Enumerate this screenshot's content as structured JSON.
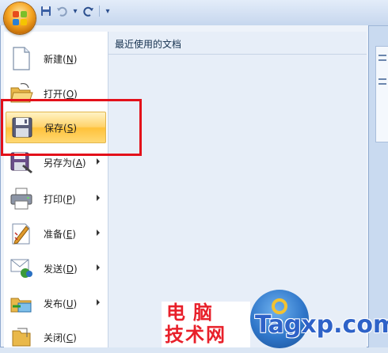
{
  "quick_access": {
    "icons": [
      "save-icon",
      "undo-icon",
      "undo-dropdown-icon",
      "redo-icon",
      "customize-icon"
    ],
    "customize_glyph": "▾"
  },
  "office_menu": {
    "items": [
      {
        "label": "新建",
        "key": "N",
        "icon": "new-document-icon",
        "submenu": false,
        "selected": false
      },
      {
        "label": "打开",
        "key": "O",
        "icon": "open-folder-icon",
        "submenu": false,
        "selected": false
      },
      {
        "label": "保存",
        "key": "S",
        "icon": "save-disk-icon",
        "submenu": false,
        "selected": true
      },
      {
        "label": "另存为",
        "key": "A",
        "icon": "save-as-icon",
        "submenu": true,
        "selected": false
      },
      {
        "label": "打印",
        "key": "P",
        "icon": "printer-icon",
        "submenu": true,
        "selected": false
      },
      {
        "label": "准备",
        "key": "E",
        "icon": "prepare-icon",
        "submenu": true,
        "selected": false
      },
      {
        "label": "发送",
        "key": "D",
        "icon": "send-icon",
        "submenu": true,
        "selected": false
      },
      {
        "label": "发布",
        "key": "U",
        "icon": "publish-icon",
        "submenu": true,
        "selected": false
      },
      {
        "label": "关闭",
        "key": "C",
        "icon": "close-folder-icon",
        "submenu": false,
        "selected": false
      }
    ],
    "recent_title": "最近使用的文档"
  },
  "watermark": {
    "cn_line1": "电脑",
    "cn_line2": "技术网",
    "en": "Tagxp.com"
  },
  "colors": {
    "selected_top": "#fff3c5",
    "selected_bottom": "#ffc23a",
    "highlight_box": "#e3101a",
    "watermark_red": "#e8202a",
    "watermark_blue": "#2e62c8"
  }
}
